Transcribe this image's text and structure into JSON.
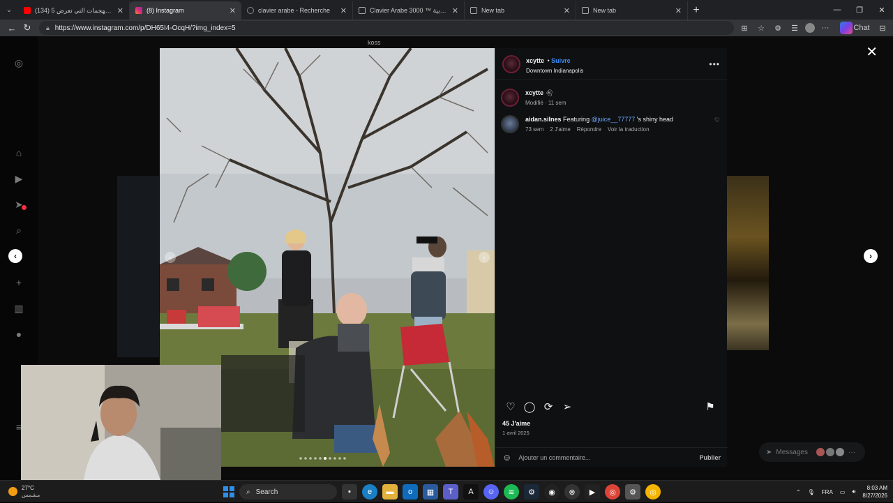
{
  "browser": {
    "tabs": [
      {
        "title": "(134) 5 من أخطر الهجمات التي تعرض",
        "fav_color": "#ff0000",
        "active": false
      },
      {
        "title": "(8) Instagram",
        "fav_color": "#d6249f",
        "active": true
      },
      {
        "title": "clavier arabe - Recherche",
        "fav_color": "#555555",
        "active": false
      },
      {
        "title": "Clavier Arabe 3000 ™ الكتابة بالعربية",
        "fav_color": "#888888",
        "active": false
      },
      {
        "title": "New tab",
        "fav_color": "#777777",
        "active": false
      },
      {
        "title": "New tab",
        "fav_color": "#777777",
        "active": false
      }
    ],
    "url": "https://www.instagram.com/p/DH65I4-OcqH/?img_index=5",
    "chat_label": "Chat"
  },
  "post": {
    "username": "xcytte",
    "follow_label": "Suivre",
    "location": "Downtown Indianapolis",
    "caption_user": "xcytte",
    "caption_meta": "Modifié · 11 sem",
    "comment": {
      "user": "aidan.silnes",
      "text_before": "Featuring",
      "mention": "@juice__77777",
      "text_after": "'s shiny head",
      "time": "73 sem",
      "likes": "2 J'aime",
      "reply": "Répondre",
      "translate": "Voir la traduction"
    },
    "likes_count": "45 J'aime",
    "date": "1 avril 2025",
    "add_comment_placeholder": "Ajouter un commentaire...",
    "publish_label": "Publier",
    "photo_overlay_text": "koss"
  },
  "messages_label": "Messages",
  "taskbar": {
    "temp": "27°C",
    "weather": "مشمس",
    "search_placeholder": "Search",
    "lang": "FRA",
    "time": "8:03 AM",
    "date": "8/27/2026"
  },
  "colors": {
    "accent_blue": "#3b8ff7",
    "notification_red": "#ff3040"
  }
}
